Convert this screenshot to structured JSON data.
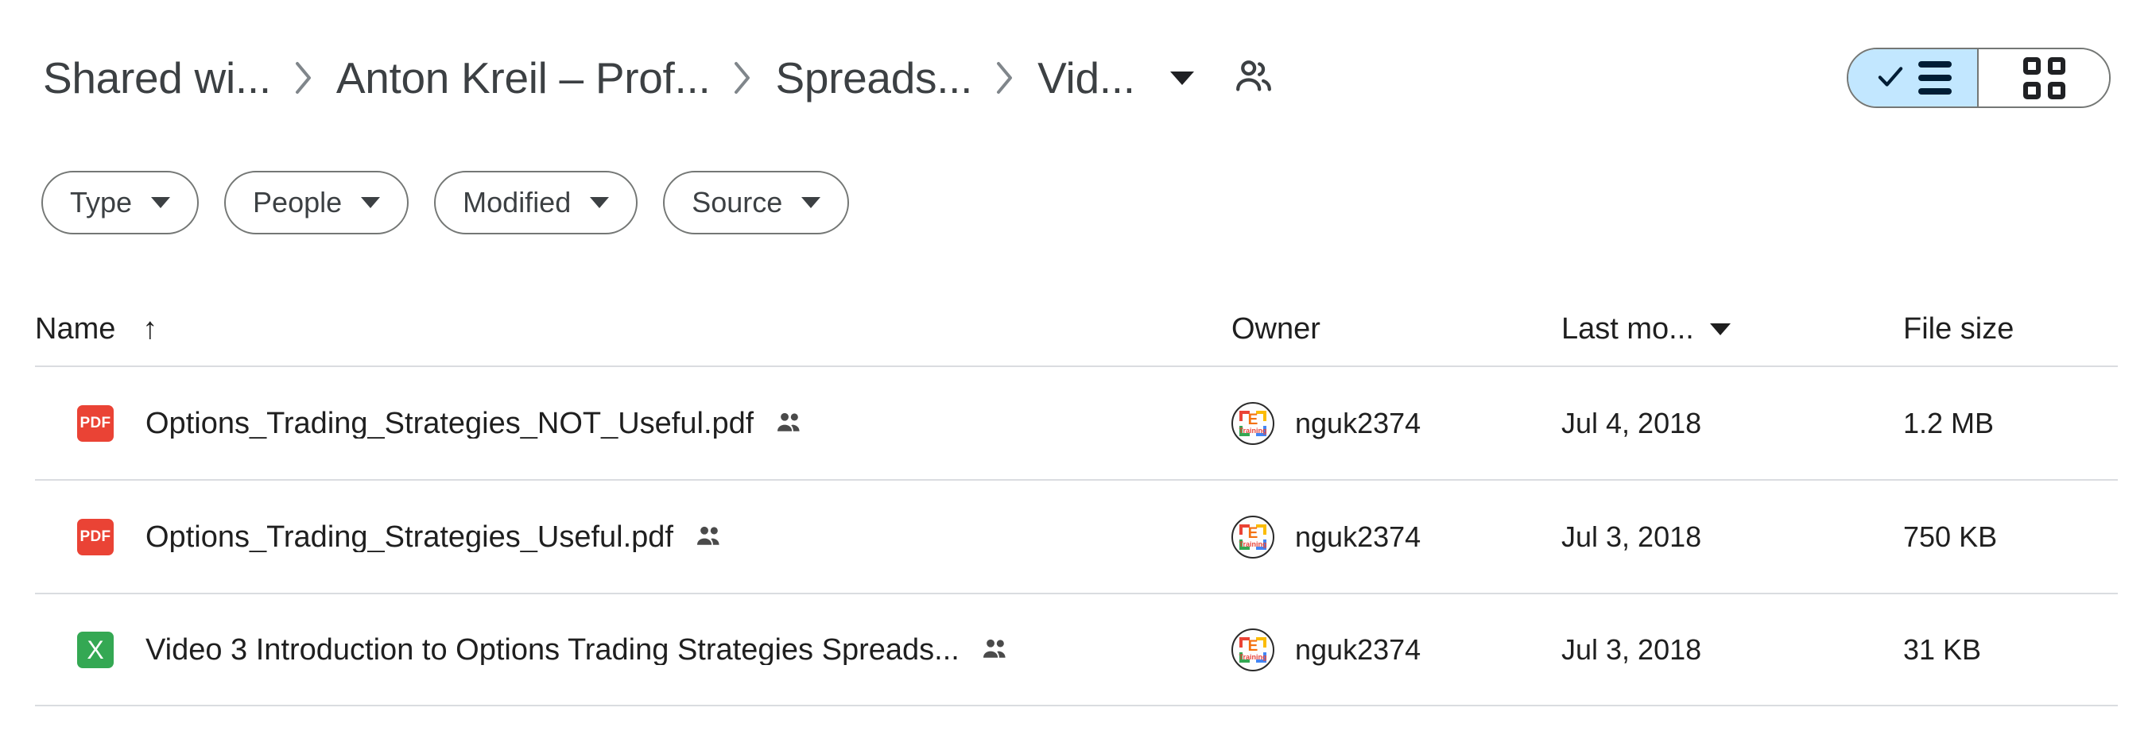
{
  "header": {
    "breadcrumb": [
      {
        "label": "Shared wi...",
        "name": "breadcrumb-item-shared-with-me"
      },
      {
        "label": "Anton Kreil – Prof...",
        "name": "breadcrumb-item-anton-kreil"
      },
      {
        "label": "Spreads...",
        "name": "breadcrumb-item-spreadsheets"
      },
      {
        "label": "Vid...",
        "name": "breadcrumb-item-video"
      }
    ],
    "dropdown_icon": "chevron-down-icon",
    "people_icon": "people-shared-icon",
    "view_toggle": {
      "list_icon": "list-view-check-icon",
      "grid_icon": "grid-view-icon",
      "active": "list",
      "active_bg": "#c2e7ff"
    }
  },
  "filters": [
    {
      "label": "Type",
      "name": "filter-chip-type"
    },
    {
      "label": "People",
      "name": "filter-chip-people"
    },
    {
      "label": "Modified",
      "name": "filter-chip-modified"
    },
    {
      "label": "Source",
      "name": "filter-chip-source"
    }
  ],
  "table": {
    "columns": {
      "name": "Name",
      "owner": "Owner",
      "modified": "Last mo...",
      "size": "File size"
    },
    "sort": {
      "name_arrow": "↑",
      "modified_caret": "chevron-down-icon"
    },
    "rows": [
      {
        "icon": "pdf-file-icon",
        "icon_label": "PDF",
        "name": "Options_Trading_Strategies_NOT_Useful.pdf",
        "shared_icon": "shared-people-icon",
        "owner": "nguk2374",
        "avatar_letter": "E",
        "avatar_sub": "Training",
        "modified": "Jul 4, 2018",
        "size": "1.2 MB"
      },
      {
        "icon": "pdf-file-icon",
        "icon_label": "PDF",
        "name": "Options_Trading_Strategies_Useful.pdf",
        "shared_icon": "shared-people-icon",
        "owner": "nguk2374",
        "avatar_letter": "E",
        "avatar_sub": "Training",
        "modified": "Jul 3, 2018",
        "size": "750 KB"
      },
      {
        "icon": "excel-file-icon",
        "icon_label": "X",
        "name": "Video 3 Introduction to Options Trading Strategies Spreads...",
        "shared_icon": "shared-people-icon",
        "owner": "nguk2374",
        "avatar_letter": "E",
        "avatar_sub": "Training",
        "modified": "Jul 3, 2018",
        "size": "31 KB"
      }
    ]
  },
  "colors": {
    "pdf": "#ea4335",
    "excel": "#34a853",
    "toggle_active": "#c2e7ff",
    "border": "#dadce0",
    "text": "#1f1f1f"
  }
}
